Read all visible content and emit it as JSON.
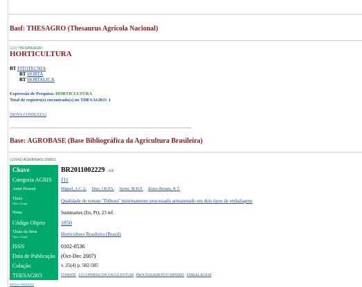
{
  "basf": {
    "heading": "Basf: THESAGRO (Thesaurus Agrícola Nacional)",
    "record_id": "(1/1) THES/BINAGRI",
    "term": "HORTICULTURA",
    "bt_label": "BT",
    "bt_value": "FITOTECNIA",
    "rt_label": "RT",
    "rt_values": [
      "HORTA",
      "HORTALICA"
    ],
    "expr_label": "Expressão de Pesquisa:",
    "expr_value": "HORTICULTURA",
    "total_label": "Total de registro(s) encontrado(s) no THESAGRO:",
    "total_value": "1",
    "nova_consulta": "[NOVA CONSULTA]"
  },
  "base": {
    "heading": "Base: AGROBASE (Base Bibliográfica da Agricultura Brasileira)",
    "record_id": "(1/2041) AGB/BINAGI-258561"
  },
  "record": {
    "chave_label": "Chave",
    "chave_value": "BR2011002229",
    "chave_suffix": "- AS",
    "categoria_label": "Categoria AGRIS",
    "categoria_value": "J11",
    "autor_label": "Autor Pessoal",
    "autores": [
      "Miguel, A.C.A.",
      "Dias, J.R.P.S.",
      "Spoto, M.H.F.",
      "Rizzo-Benato, R.T."
    ],
    "titulo_label": "Título",
    "titulo_sub": "Veja+ Google",
    "titulo_value": "Qualidade de tomate \"Débora\" minimamente processado armazenado em dois tipos de embalagens",
    "notas_label": "Notas",
    "notas_value": "Summaries (En, Pt); 23 ref.",
    "codigo_label": "Código Objeto",
    "codigo_value": "1850",
    "serie_label": "Título da Série",
    "serie_sub": "Veja+ Google",
    "serie_value": "Horticultura Brasileira (Brazil)",
    "issn_label": "ISSN",
    "issn_value": "0102-0536",
    "data_label": "Data de Publicação",
    "data_value": "(Oct-Dec 2007)",
    "colacao_label": "Colação",
    "colacao_value": "v. 25(4) p. 582-585",
    "thesagro_label": "THESAGRO",
    "thesagro_values": [
      "TOMATE",
      "LYCOPERSICON ESCULENTUM",
      "PROCESSAMENTO MINIMO",
      "EMBALAGEM"
    ]
  },
  "footer": {
    "link_text": "[NOVA CONSULTA]"
  }
}
